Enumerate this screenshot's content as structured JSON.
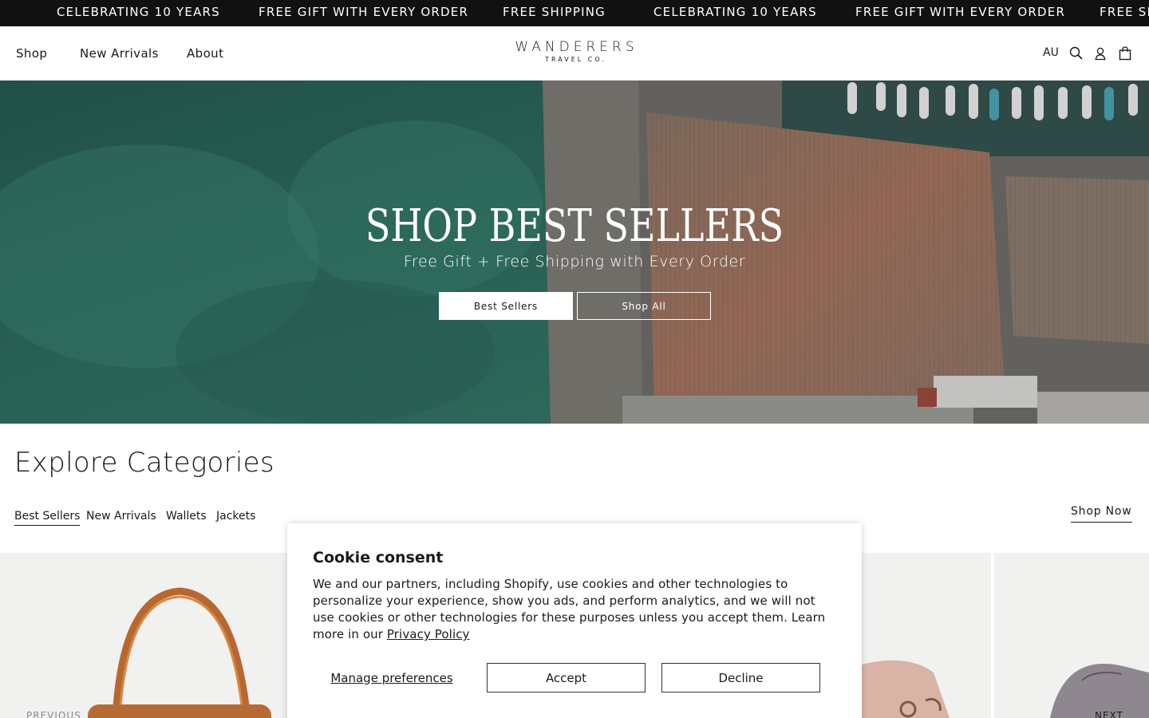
{
  "announcement": {
    "items": [
      "CELEBRATING 10 YEARS",
      "FREE GIFT WITH EVERY ORDER",
      "FREE SHIPPING",
      "CELEBRATING 10 YEARS",
      "FREE GIFT WITH EVERY ORDER",
      "FREE SH"
    ]
  },
  "header": {
    "nav": [
      "Shop",
      "New Arrivals",
      "About"
    ],
    "logo_main": "WANDERERS",
    "logo_sub": "TRAVEL CO.",
    "locale": "AU",
    "icons": [
      "search-icon",
      "account-icon",
      "cart-icon"
    ]
  },
  "hero": {
    "title": "SHOP BEST SELLERS",
    "subtitle": "Free Gift + Free Shipping with Every Order",
    "primary_button": "Best Sellers",
    "secondary_button": "Shop All"
  },
  "categories": {
    "title": "Explore Categories",
    "tabs": [
      "Best Sellers",
      "New Arrivals",
      "Wallets",
      "Jackets"
    ],
    "active_tab": "Best Sellers",
    "shop_now": "Shop Now",
    "previous": "PREVIOUS",
    "next": "NEXT"
  },
  "cookie": {
    "title": "Cookie consent",
    "body": "We and our partners, including Shopify, use cookies and other technologies to personalize your experience, show you ads, and perform analytics, and we will not use cookies or other technologies for these purposes unless you accept them. Learn more in our",
    "policy_link": "Privacy Policy",
    "manage": "Manage preferences",
    "accept": "Accept",
    "decline": "Decline"
  },
  "colors": {
    "announcement_bg": "#111111",
    "text": "#1a1a1a",
    "water": "#2f6b5c",
    "roof": "#9b6f5e"
  }
}
